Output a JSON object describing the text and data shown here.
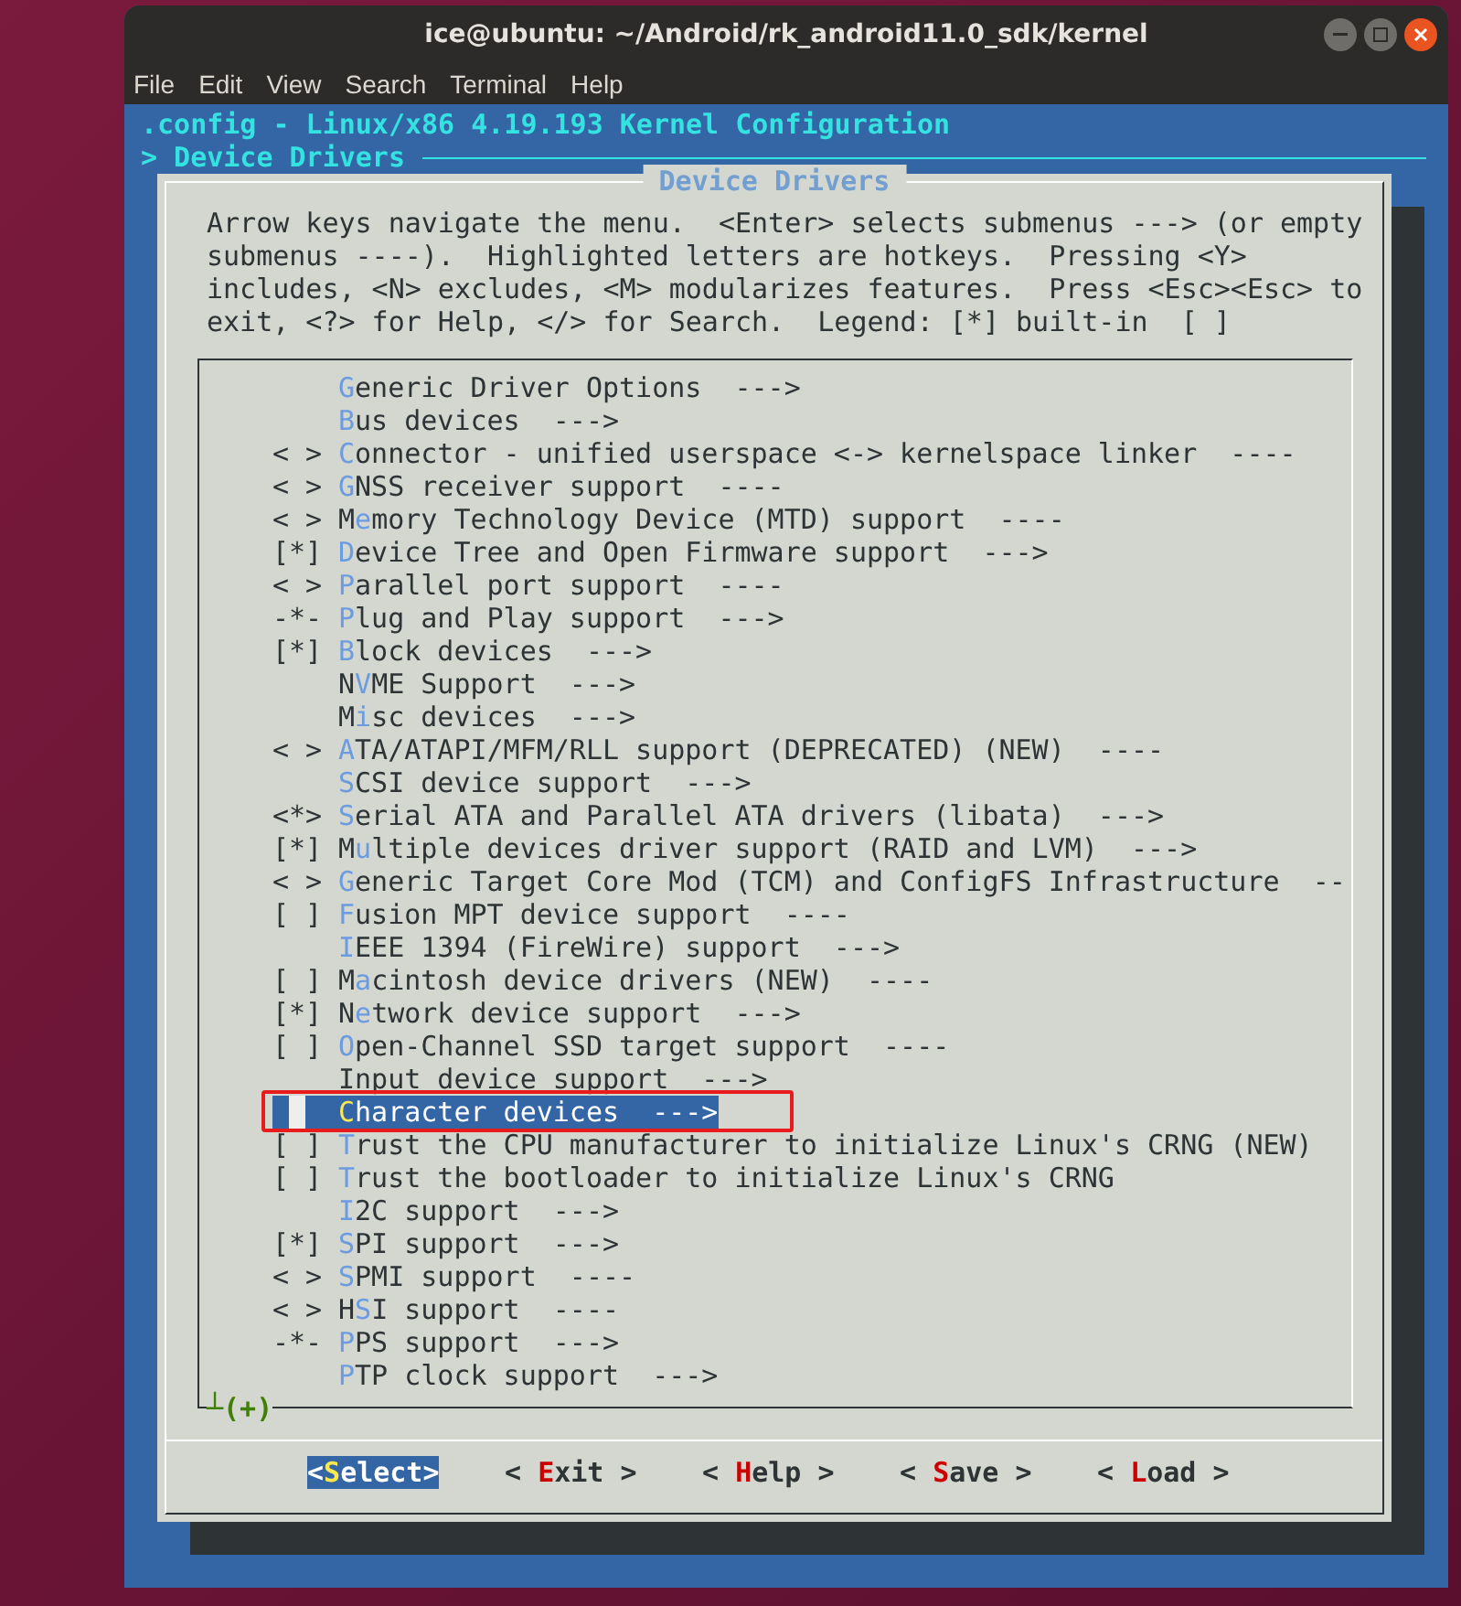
{
  "window": {
    "title": "ice@ubuntu: ~/Android/rk_android11.0_sdk/kernel",
    "menu": [
      "File",
      "Edit",
      "View",
      "Search",
      "Terminal",
      "Help"
    ]
  },
  "terminal": {
    "header": ".config - Linux/x86 4.19.193 Kernel Configuration",
    "breadcrumb": "> Device Drivers",
    "dialog": {
      "title": "Device Drivers",
      "help": "Arrow keys navigate the menu.  <Enter> selects submenus ---> (or empty\nsubmenus ----).  Highlighted letters are hotkeys.  Pressing <Y>\nincludes, <N> excludes, <M> modularizes features.  Press <Esc><Esc> to\nexit, <?> for Help, </> for Search.  Legend: [*] built-in  [ ]",
      "items": [
        {
          "label": "**G**eneric Driver Options  --->",
          "selected": false,
          "annotated": false
        },
        {
          "label": "**B**us devices  --->",
          "selected": false,
          "annotated": false
        },
        {
          "prefix": "< >",
          "label": "**C**onnector - unified userspace <-> kernelspace linker  ----",
          "selected": false,
          "annotated": false
        },
        {
          "prefix": "< >",
          "label": "**G**NSS receiver support  ----",
          "selected": false,
          "annotated": false
        },
        {
          "prefix": "< >",
          "label": "M**e**mory Technology Device (MTD) support  ----",
          "selected": false,
          "annotated": false
        },
        {
          "prefix": "[*]",
          "label": "**D**evice Tree and Open Firmware support  --->",
          "selected": false,
          "annotated": false
        },
        {
          "prefix": "< >",
          "label": "**P**arallel port support  ----",
          "selected": false,
          "annotated": false
        },
        {
          "prefix": "-*-",
          "label": "**P**lug and Play support  --->",
          "selected": false,
          "annotated": false
        },
        {
          "prefix": "[*]",
          "label": "**B**lock devices  --->",
          "selected": false,
          "annotated": false
        },
        {
          "label": "N**V**ME Support  --->",
          "selected": false,
          "annotated": false
        },
        {
          "label": "M**i**sc devices  --->",
          "selected": false,
          "annotated": false
        },
        {
          "prefix": "< >",
          "label": "**A**TA/ATAPI/MFM/RLL support (DEPRECATED) (NEW)  ----",
          "selected": false,
          "annotated": false
        },
        {
          "label": "**S**CSI device support  --->",
          "selected": false,
          "annotated": false
        },
        {
          "prefix": "<*>",
          "label": "**S**erial ATA and Parallel ATA drivers (libata)  --->",
          "selected": false,
          "annotated": false
        },
        {
          "prefix": "[*]",
          "label": "M**u**ltiple devices driver support (RAID and LVM)  --->",
          "selected": false,
          "annotated": false
        },
        {
          "prefix": "< >",
          "label": "**G**eneric Target Core Mod (TCM) and ConfigFS Infrastructure  --",
          "selected": false,
          "annotated": false
        },
        {
          "prefix": "[ ]",
          "label": "**F**usion MPT device support  ----",
          "selected": false,
          "annotated": false
        },
        {
          "label": "**I**EEE 1394 (FireWire) support  --->",
          "selected": false,
          "annotated": false
        },
        {
          "prefix": "[ ]",
          "label": "M**a**cintosh device drivers (NEW)  ----",
          "selected": false,
          "annotated": false
        },
        {
          "prefix": "[*]",
          "label": "N**e**twork device support  --->",
          "selected": false,
          "annotated": false
        },
        {
          "prefix": "[ ]",
          "label": "**O**pen-Channel SSD target support  ----",
          "selected": false,
          "annotated": false
        },
        {
          "label": "Input device support  --->",
          "selected": false,
          "annotated": false
        },
        {
          "label": "**C**haracter devices  --->",
          "selected": true,
          "annotated": true
        },
        {
          "prefix": "[ ]",
          "label": "**T**rust the CPU manufacturer to initialize Linux's CRNG (NEW)",
          "selected": false,
          "annotated": false
        },
        {
          "prefix": "[ ]",
          "label": "**T**rust the bootloader to initialize Linux's CRNG",
          "selected": false,
          "annotated": false
        },
        {
          "label": "**I**2C support  --->",
          "selected": false,
          "annotated": false
        },
        {
          "prefix": "[*]",
          "label": "**S**PI support  --->",
          "selected": false,
          "annotated": false
        },
        {
          "prefix": "< >",
          "label": "**S**PMI support  ----",
          "selected": false,
          "annotated": false
        },
        {
          "prefix": "< >",
          "label": "H**S**I support  ----",
          "selected": false,
          "annotated": false
        },
        {
          "prefix": "-*-",
          "label": "**P**PS support  --->",
          "selected": false,
          "annotated": false
        },
        {
          "label": "**P**TP clock support  --->",
          "selected": false,
          "annotated": false
        }
      ],
      "more_indicator": "┴(+)",
      "buttons": [
        {
          "label": "<**S**elect>",
          "selected": true
        },
        {
          "label": "< **E**xit >",
          "selected": false
        },
        {
          "label": "< **H**elp >",
          "selected": false
        },
        {
          "label": "< **S**ave >",
          "selected": false
        },
        {
          "label": "< **L**oad >",
          "selected": false
        }
      ]
    }
  }
}
